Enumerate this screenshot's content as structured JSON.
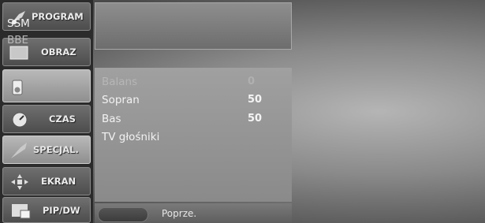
{
  "sidebar": {
    "items": [
      {
        "label": "PROGRAM",
        "icon": "satellite-icon"
      },
      {
        "label": "OBRAZ",
        "icon": "picture-icon"
      },
      {
        "label": "",
        "icon": "speaker-icon"
      },
      {
        "label": "CZAS",
        "icon": "clock-icon"
      },
      {
        "label": "SPECJAL.",
        "icon": "special-tag-icon"
      },
      {
        "label": "EKRAN",
        "icon": "screen-arrows-icon"
      },
      {
        "label": "PIP/DW",
        "icon": "pip-icon"
      }
    ]
  },
  "menu": {
    "top_items": [
      "SSM",
      "BBE"
    ],
    "rows": [
      {
        "label": "Balans",
        "value": "0"
      },
      {
        "label": "Sopran",
        "value": "50"
      },
      {
        "label": "Bas",
        "value": "50"
      },
      {
        "label": "TV głośniki",
        "value": ""
      }
    ]
  },
  "footer": {
    "prev_label": "Poprze."
  }
}
